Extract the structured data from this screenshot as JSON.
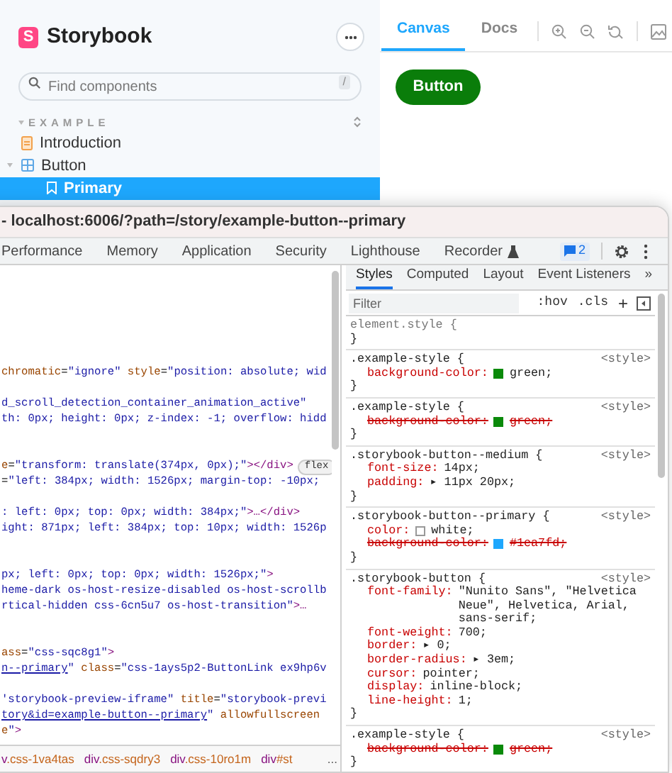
{
  "storybook": {
    "brand": "Storybook",
    "logo_mark": "S",
    "search": {
      "placeholder": "Find components",
      "shortcut": "/"
    },
    "tree": {
      "section": "EXAMPLE",
      "items": [
        {
          "label": "Introduction",
          "kind": "doc",
          "expanded": false,
          "selected": false
        },
        {
          "label": "Button",
          "kind": "component",
          "expanded": true,
          "selected": false,
          "children": [
            {
              "label": "Primary",
              "kind": "story",
              "expanded": false,
              "selected": true
            }
          ]
        }
      ]
    },
    "preview_tabs": [
      {
        "label": "Canvas",
        "selected": true
      },
      {
        "label": "Docs",
        "selected": false
      }
    ],
    "preview_button": {
      "label": "Button"
    }
  },
  "devtools": {
    "title": "- localhost:6006/?path=/story/example-button--primary",
    "tabs": [
      {
        "label": "Performance",
        "kind": "plain"
      },
      {
        "label": "Memory",
        "kind": "plain"
      },
      {
        "label": "Application",
        "kind": "plain"
      },
      {
        "label": "Security",
        "kind": "plain"
      },
      {
        "label": "Lighthouse",
        "kind": "plain"
      },
      {
        "label": "Recorder",
        "kind": "flask"
      }
    ],
    "issues_count": "2",
    "elements": {
      "lines": [
        {
          "kind": "blank"
        },
        {
          "kind": "blank"
        },
        {
          "kind": "blank"
        },
        {
          "kind": "blank"
        },
        {
          "kind": "blank"
        },
        {
          "kind": "blank"
        },
        {
          "kind": "code",
          "segments": [
            {
              "kind": "attr",
              "text": "chromatic"
            },
            {
              "kind": "plain",
              "text": "="
            },
            {
              "kind": "value",
              "text": "\"ignore\""
            },
            {
              "kind": "attr",
              "text": " style"
            },
            {
              "kind": "plain",
              "text": "="
            },
            {
              "kind": "value",
              "text": "\"position: absolute; wid"
            }
          ]
        },
        {
          "kind": "blank"
        },
        {
          "kind": "code",
          "segments": [
            {
              "kind": "value",
              "text": "d_scroll_detection_container_animation_active\""
            }
          ]
        },
        {
          "kind": "code",
          "segments": [
            {
              "kind": "value",
              "text": "th: 0px; height: 0px; z-index: -1; overflow: hidd"
            }
          ]
        },
        {
          "kind": "blank"
        },
        {
          "kind": "blank"
        },
        {
          "kind": "code",
          "badge": "flex",
          "segments": [
            {
              "kind": "attr",
              "text": "e"
            },
            {
              "kind": "plain",
              "text": "="
            },
            {
              "kind": "value",
              "text": "\"transform: translate(374px, 0px);\""
            },
            {
              "kind": "tag",
              "text": "></div>"
            }
          ]
        },
        {
          "kind": "code",
          "segments": [
            {
              "kind": "plain",
              "text": "="
            },
            {
              "kind": "value",
              "text": "\"left: 384px; width: 1526px; margin-top: -10px;"
            }
          ]
        },
        {
          "kind": "blank"
        },
        {
          "kind": "code",
          "segments": [
            {
              "kind": "value",
              "text": ": left: 0px; top: 0px; width: 384px;\""
            },
            {
              "kind": "tag",
              "text": ">…</div>"
            }
          ]
        },
        {
          "kind": "code",
          "segments": [
            {
              "kind": "value",
              "text": "ight: 871px; left: 384px; top: 10px; width: 1526p"
            }
          ]
        },
        {
          "kind": "blank"
        },
        {
          "kind": "blank"
        },
        {
          "kind": "code",
          "segments": [
            {
              "kind": "value",
              "text": "px; left: 0px; top: 0px; width: 1526px;\""
            },
            {
              "kind": "tag",
              "text": ">"
            }
          ]
        },
        {
          "kind": "code",
          "segments": [
            {
              "kind": "value",
              "text": "heme-dark os-host-resize-disabled os-host-scrollb"
            }
          ]
        },
        {
          "kind": "code",
          "segments": [
            {
              "kind": "value",
              "text": "rtical-hidden css-6cn5u7 os-host-transition\""
            },
            {
              "kind": "tag",
              "text": ">…"
            }
          ]
        },
        {
          "kind": "blank"
        },
        {
          "kind": "blank"
        },
        {
          "kind": "code",
          "segments": [
            {
              "kind": "attr",
              "text": "ass"
            },
            {
              "kind": "plain",
              "text": "="
            },
            {
              "kind": "value",
              "text": "\"css-sqc8g1\""
            },
            {
              "kind": "tag",
              "text": ">"
            }
          ]
        },
        {
          "kind": "code",
          "segments": [
            {
              "kind": "link",
              "text": "n--primary"
            },
            {
              "kind": "value",
              "text": "\""
            },
            {
              "kind": "attr",
              "text": " class"
            },
            {
              "kind": "plain",
              "text": "="
            },
            {
              "kind": "value",
              "text": "\"css-1ays5p2-ButtonLink ex9hp6v"
            }
          ]
        },
        {
          "kind": "blank"
        },
        {
          "kind": "code",
          "segments": [
            {
              "kind": "value",
              "text": "'storybook-preview-iframe\""
            },
            {
              "kind": "attr",
              "text": " title"
            },
            {
              "kind": "plain",
              "text": "="
            },
            {
              "kind": "value",
              "text": "\"storybook-previ"
            }
          ]
        },
        {
          "kind": "code",
          "segments": [
            {
              "kind": "link",
              "text": "tory&id=example-button--primary"
            },
            {
              "kind": "value",
              "text": "\""
            },
            {
              "kind": "attr",
              "text": " allowfullscreen"
            }
          ]
        },
        {
          "kind": "code",
          "segments": [
            {
              "kind": "attr",
              "text": "e"
            },
            {
              "kind": "value",
              "text": "\""
            },
            {
              "kind": "tag",
              "text": ">"
            }
          ]
        }
      ]
    },
    "breadcrumbs": [
      {
        "label": "v.css-1va4tas"
      },
      {
        "label": "div.css-sqdry3"
      },
      {
        "label": "div.css-10ro1m"
      },
      {
        "label": "div#st"
      }
    ],
    "breadcrumbs_more": "...",
    "styles": {
      "tabs": [
        {
          "label": "Styles",
          "selected": true
        },
        {
          "label": "Computed",
          "selected": false
        },
        {
          "label": "Layout",
          "selected": false
        },
        {
          "label": "Event Listeners",
          "selected": false
        },
        {
          "label": "»",
          "selected": false
        }
      ],
      "filter_placeholder": "Filter",
      "hov": ":hov",
      "cls": ".cls",
      "add": "+",
      "rules": [
        {
          "selector": "element.style {",
          "kind": "inline",
          "close": "}"
        },
        {
          "selector": ".example-style {",
          "kind": "sheet",
          "source": "<style>",
          "close": "}",
          "declarations": [
            {
              "prop": "background-color:",
              "value": "green;",
              "overridden": false,
              "color": "#0a8a0a"
            }
          ]
        },
        {
          "selector": ".example-style {",
          "kind": "sheet",
          "source": "<style>",
          "close": "}",
          "declarations": [
            {
              "prop": "background-color:",
              "value": "green;",
              "overridden": true,
              "color": "#0a8a0a"
            }
          ]
        },
        {
          "selector": ".storybook-button--medium {",
          "kind": "sheet",
          "source": "<style>",
          "close": "}",
          "declarations": [
            {
              "prop": "font-size:",
              "value": "14px;",
              "overridden": false
            },
            {
              "prop": "padding:",
              "value": "▸ 11px 20px;",
              "overridden": false
            }
          ]
        },
        {
          "selector": ".storybook-button--primary {",
          "kind": "sheet",
          "source": "<style>",
          "close": "}",
          "declarations": [
            {
              "prop": "color:",
              "value": "white;",
              "overridden": false,
              "color": "#ffffff"
            },
            {
              "prop": "background-color:",
              "value": "#1ea7fd;",
              "overridden": true,
              "color": "#1ea7fd"
            }
          ]
        },
        {
          "selector": ".storybook-button {",
          "kind": "sheet",
          "source": "<style>",
          "close": "}",
          "declarations": [
            {
              "prop": "font-family:",
              "value": "\"Nunito Sans\", \"Helvetica Neue\", Helvetica, Arial, sans-serif;",
              "overridden": false
            },
            {
              "prop": "font-weight:",
              "value": "700;",
              "overridden": false
            },
            {
              "prop": "border:",
              "value": "▸ 0;",
              "overridden": false
            },
            {
              "prop": "border-radius:",
              "value": "▸ 3em;",
              "overridden": false
            },
            {
              "prop": "cursor:",
              "value": "pointer;",
              "overridden": false
            },
            {
              "prop": "display:",
              "value": "inline-block;",
              "overridden": false
            },
            {
              "prop": "line-height:",
              "value": "1;",
              "overridden": false
            }
          ]
        },
        {
          "selector": ".example-style {",
          "kind": "sheet",
          "source": "<style>",
          "close": "}",
          "declarations": [
            {
              "prop": "background-color:",
              "value": "green;",
              "overridden": true,
              "color": "#0a8a0a"
            }
          ]
        }
      ]
    }
  }
}
